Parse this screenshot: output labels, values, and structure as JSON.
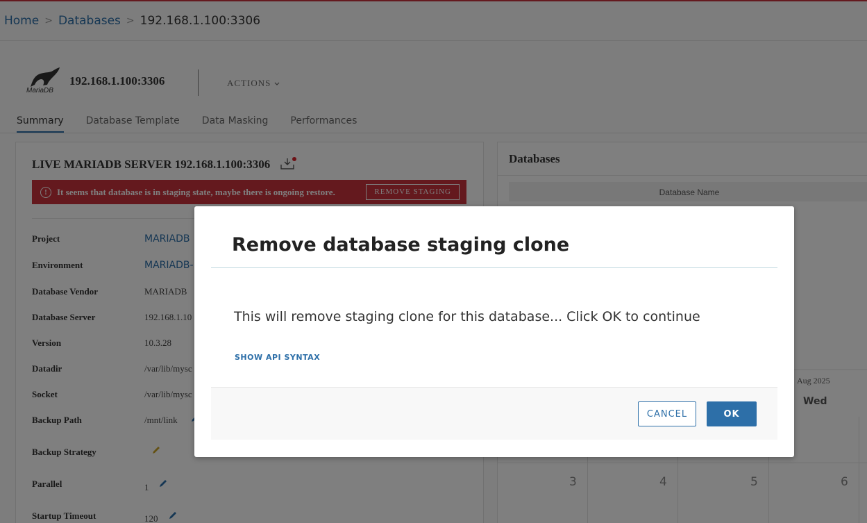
{
  "breadcrumb": {
    "items": [
      "Home",
      "Databases"
    ],
    "separator": ">",
    "current": "192.168.1.100:3306"
  },
  "server": {
    "logo_text": "MariaDB",
    "title": "192.168.1.100:3306",
    "actions_label": "ACTIONS"
  },
  "tabs": [
    {
      "label": "Summary",
      "active": true
    },
    {
      "label": "Database Template",
      "active": false
    },
    {
      "label": "Data Masking",
      "active": false
    },
    {
      "label": "Performances",
      "active": false
    }
  ],
  "summary": {
    "title": "LIVE MARIADB SERVER 192.168.1.100:3306",
    "alert_text": "It seems that database is in staging state, maybe there is ongoing restore.",
    "alert_button": "REMOVE STAGING",
    "properties": [
      {
        "label": "Project",
        "value": "MARIADB"
      },
      {
        "label": "Environment",
        "value": "MARIADB-"
      },
      {
        "label": "Database Vendor",
        "value": "MARIADB"
      },
      {
        "label": "Database Server",
        "value": "192.168.1.10"
      },
      {
        "label": "Version",
        "value": "10.3.28"
      },
      {
        "label": "Datadir",
        "value": "/var/lib/mysc"
      },
      {
        "label": "Socket",
        "value": "/var/lib/mysc"
      },
      {
        "label": "Backup Path",
        "value": "/mnt/link"
      },
      {
        "label": "Backup Strategy",
        "value": ""
      },
      {
        "label": "Parallel",
        "value": "1"
      },
      {
        "label": "Startup Timeout",
        "value": "120"
      }
    ]
  },
  "databases": {
    "title": "Databases",
    "column": "Database Name"
  },
  "calendar": {
    "month": "Aug 2025",
    "day": "Wed",
    "numbers": [
      "3",
      "4",
      "5",
      "6"
    ]
  },
  "modal": {
    "title": "Remove database staging clone",
    "body": "This will remove staging clone for this database... Click OK to continue",
    "api_link": "SHOW API SYNTAX",
    "cancel_label": "CANCEL",
    "ok_label": "OK"
  },
  "colors": {
    "accent": "#2d6fa8",
    "alert": "#c8323c"
  }
}
